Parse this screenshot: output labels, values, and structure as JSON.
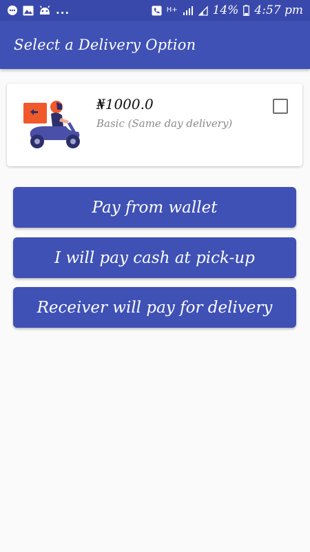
{
  "status_bar": {
    "left_icons": [
      "messenger-icon",
      "gallery-icon",
      "android-icon"
    ],
    "overflow": "...",
    "network_label": "H+",
    "battery_percent": "14%",
    "time": "4:57 pm"
  },
  "app_bar": {
    "title": "Select a Delivery Option"
  },
  "delivery_option": {
    "price": "₦1000.0",
    "description": "Basic (Same day delivery)",
    "checked": false
  },
  "buttons": {
    "pay_wallet": "Pay from wallet",
    "pay_cash": "I will pay cash at pick-up",
    "receiver_pays": "Receiver will pay for delivery"
  },
  "colors": {
    "primary": "#3f51b5",
    "primary_dark": "#3949ab",
    "rider_box": "#f0592a",
    "scooter": "#4a50a8"
  }
}
